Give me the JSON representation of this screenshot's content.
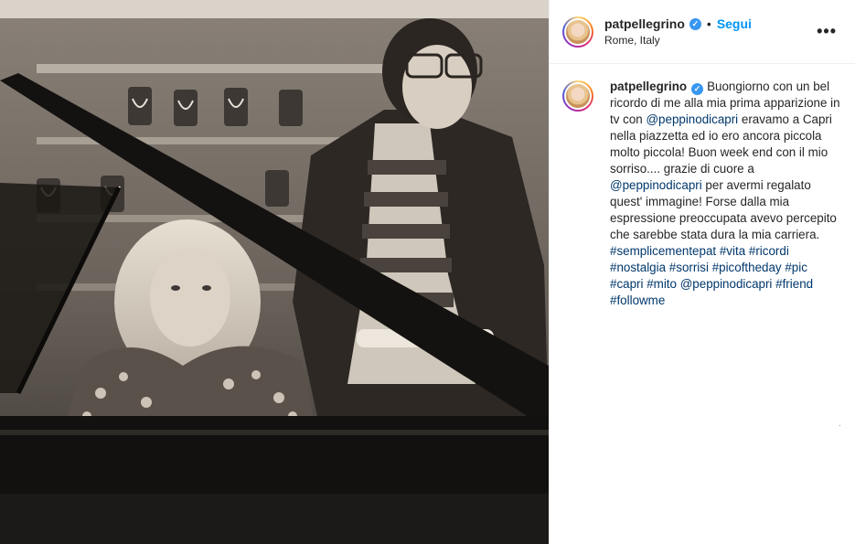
{
  "post": {
    "image_alt": "Vintage black and white photo of a young woman at a grand piano with a man standing behind her",
    "username": "patpellegrino",
    "location": "Rome, Italy",
    "follow_label": "Segui",
    "separator": "•",
    "more_label": "•••",
    "verified_glyph": "✓"
  },
  "caption": {
    "username": "patpellegrino",
    "segments": [
      {
        "text": "Buongiorno con un bel ricordo di me alla mia prima apparizione in tv con ",
        "link": false
      },
      {
        "text": "@peppinodicapri",
        "link": true
      },
      {
        "text": " eravamo a Capri nella piazzetta ed io ero ancora piccola molto piccola! Buon week end con il mio sorriso.... grazie di cuore a ",
        "link": false
      },
      {
        "text": "@peppinodicapri",
        "link": true
      },
      {
        "text": " per avermi regalato quest' immagine! Forse dalla mia espressione preoccupata avevo percepito che sarebbe stata dura la mia carriera. ",
        "link": false
      },
      {
        "text": "#semplicementepat",
        "link": true
      },
      {
        "text": " ",
        "link": false
      },
      {
        "text": "#vita",
        "link": true
      },
      {
        "text": " ",
        "link": false
      },
      {
        "text": "#ricordi",
        "link": true
      },
      {
        "text": " ",
        "link": false
      },
      {
        "text": "#nostalgia",
        "link": true
      },
      {
        "text": " ",
        "link": false
      },
      {
        "text": "#sorrisi",
        "link": true
      },
      {
        "text": " ",
        "link": false
      },
      {
        "text": "#picoftheday",
        "link": true
      },
      {
        "text": " ",
        "link": false
      },
      {
        "text": "#pic",
        "link": true
      },
      {
        "text": " ",
        "link": false
      },
      {
        "text": "#capri",
        "link": true
      },
      {
        "text": " ",
        "link": false
      },
      {
        "text": "#mito",
        "link": true
      },
      {
        "text": " ",
        "link": false
      },
      {
        "text": "@peppinodicapri",
        "link": true
      },
      {
        "text": " ",
        "link": false
      },
      {
        "text": "#friend",
        "link": true
      },
      {
        "text": " ",
        "link": false
      },
      {
        "text": "#followme",
        "link": true
      }
    ]
  },
  "stray_mark": ".",
  "colors": {
    "link": "#00376b",
    "follow": "#0095f6",
    "verified": "#3897f0",
    "text": "#262626"
  }
}
